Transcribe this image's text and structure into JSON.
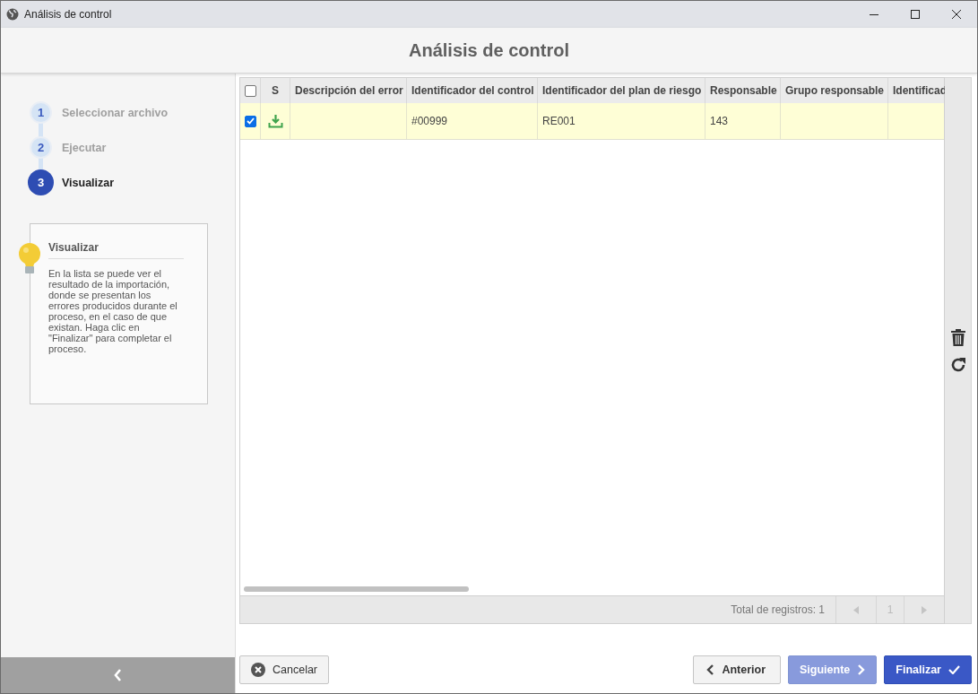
{
  "window": {
    "title": "Análisis de control"
  },
  "header": {
    "title": "Análisis de control"
  },
  "steps": [
    {
      "number": "1",
      "label": "Seleccionar archivo",
      "selected": false
    },
    {
      "number": "2",
      "label": "Ejecutar",
      "selected": false
    },
    {
      "number": "3",
      "label": "Visualizar",
      "selected": true
    }
  ],
  "tip": {
    "title": "Visualizar",
    "text": "En la lista se puede ver el resultado de la importación, donde se presentan los errores producidos durante el proceso, en el caso de que existan. Haga clic en \"Finalizar\" para completar el proceso."
  },
  "table": {
    "select_all": {
      "checked": false
    },
    "columns": [
      "S",
      "Descripción del error",
      "Identificador del control",
      "Identificador del plan de riesgo",
      "Responsable",
      "Grupo responsable",
      "Identificad"
    ],
    "rows": [
      {
        "checked": true,
        "cells": [
          "",
          "",
          "#00999",
          "RE001",
          "143",
          "",
          ""
        ]
      }
    ]
  },
  "footer": {
    "total": "Total de registros: 1",
    "page": "1"
  },
  "buttons": [
    {
      "kind": "cancel",
      "label": "Cancelar",
      "disabled": false
    },
    {
      "kind": "back",
      "label": "Anterior",
      "disabled": false
    },
    {
      "kind": "next",
      "label": "Siguiente",
      "disabled": true
    },
    {
      "kind": "finish",
      "label": "Finalizar",
      "disabled": false
    }
  ]
}
